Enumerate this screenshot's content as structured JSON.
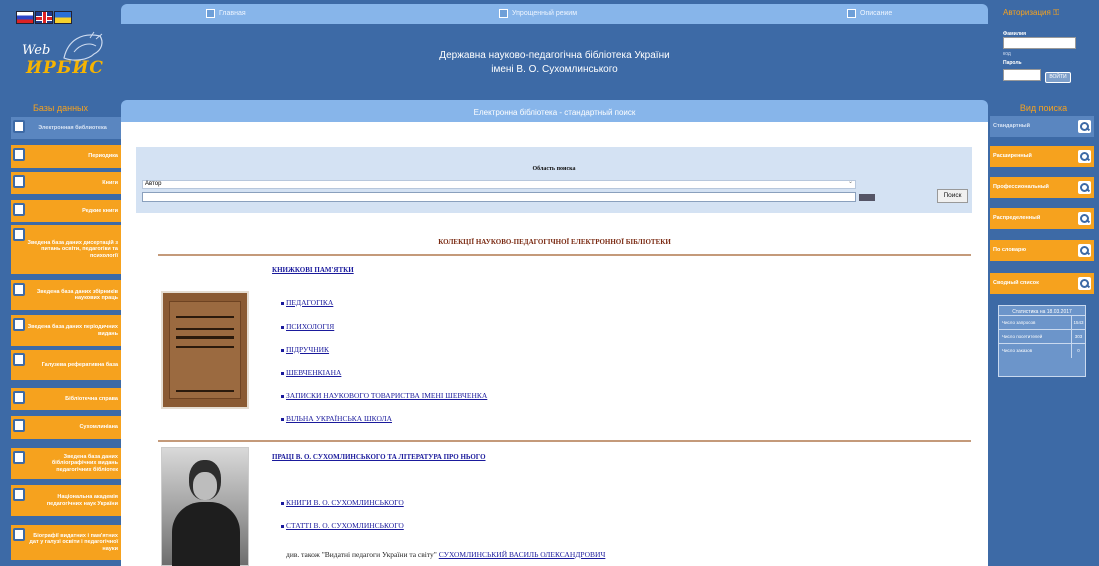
{
  "left": {
    "title": "Базы данных",
    "items": [
      "Электронная библиотека",
      "Периодика",
      "Книги",
      "Редкие книги",
      "Зведена база даних дисертацій з питань освіти, педагогіки та психології",
      "Зведена база даних збірників наукових праць",
      "Зведена база даних періодичних видань",
      "Галузева реферативна база",
      "Бібліотечна справа",
      "Сухомлиніана",
      "Зведена база даних бібліографічних видань педагогічних бібліотек",
      "Національна академія педагогічних наук України",
      "Біографії видатних і пам'ятних дат у галузі освіти і педагогічної науки"
    ]
  },
  "topmenu": [
    "Главная",
    "Упрощенный режим",
    "Описание"
  ],
  "header": {
    "line1": "Державна науково-педагогічна бібліотека України",
    "line2": "імені В. О. Сухомлинського"
  },
  "auth": {
    "title": "Авторизация",
    "surname_label": "Фамилия",
    "hint": "код",
    "password_label": "Пароль",
    "button": "ВОЙТИ"
  },
  "right": {
    "title": "Вид поиска",
    "items": [
      "Стандартный",
      "Расширенный",
      "Профессиональный",
      "Распределенный",
      "По словарю",
      "Сводный список"
    ]
  },
  "stats": {
    "title": "Статистика на 18.03.2017",
    "rows": [
      {
        "label": "Число запросов",
        "value": "1543"
      },
      {
        "label": "Число посетителей",
        "value": "303"
      },
      {
        "label": "Число заказов",
        "value": "0"
      }
    ]
  },
  "main": {
    "title": "Електронна бібліотека - стандартный поиск",
    "search": {
      "area_label": "Область поиска",
      "selected_field": "Автор",
      "query_value": "",
      "button": "Поиск"
    },
    "collections_title": "КОЛЕКЦІЇ НАУКОВО-ПЕДАГОГІЧНОЇ ЕЛЕКТРОННОЇ БІБЛІОТЕКИ",
    "section1": {
      "title": "КНИЖКОВІ ПАМ'ЯТКИ",
      "links": [
        "ПЕДАГОГІКА",
        "ПСИХОЛОГІЯ",
        "ПІДРУЧНИК",
        "ШЕВЧЕНКІАНА",
        "ЗАПИСКИ НАУКОВОГО ТОВАРИСТВА ІМЕНІ ШЕВЧЕНКА",
        "ВІЛЬНА УКРАЇНСЬКА ШКОЛА"
      ]
    },
    "section2": {
      "title": "ПРАЦІ В. О. СУХОМЛИНСЬКОГО ТА ЛІТЕРАТУРА ПРО НЬОГО",
      "links": [
        "КНИГИ В. О. СУХОМЛИНСЬКОГО",
        "СТАТТІ В. О. СУХОМЛИНСЬКОГО"
      ],
      "see_also_prefix": "див. також \"Видатні педагоги України та світу\"",
      "see_also_link": "СУХОМЛИНСЬКИЙ ВАСИЛЬ ОЛЕКСАНДРОВИЧ"
    }
  }
}
